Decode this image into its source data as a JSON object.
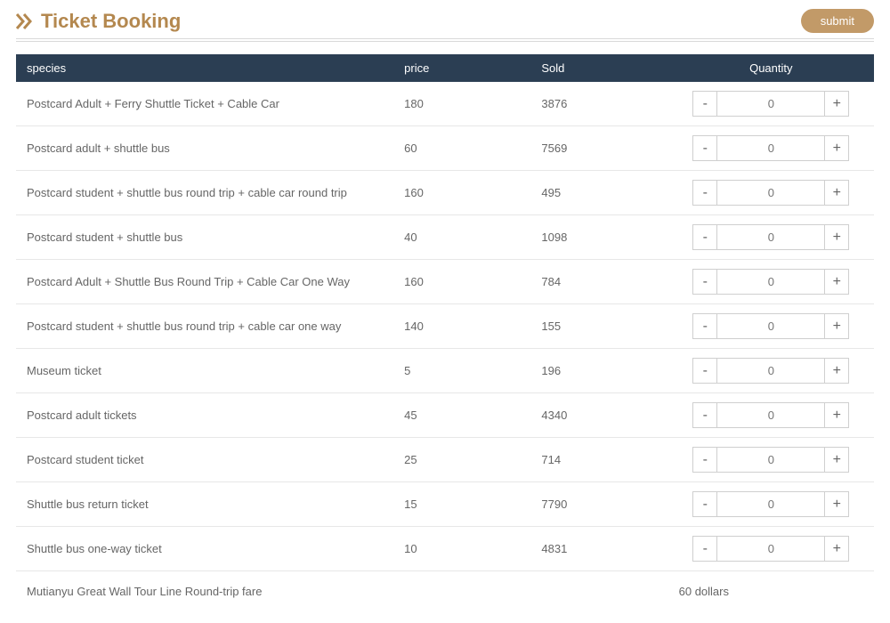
{
  "header": {
    "title": "Ticket Booking",
    "submit_label": "submit"
  },
  "columns": {
    "species": "species",
    "price": "price",
    "sold": "Sold",
    "quantity": "Quantity"
  },
  "stepper": {
    "minus": "-",
    "plus": "+",
    "placeholder": "0"
  },
  "rows": [
    {
      "species": "Postcard Adult + Ferry Shuttle Ticket + Cable Car",
      "price": "180",
      "sold": "3876"
    },
    {
      "species": "Postcard adult + shuttle bus",
      "price": "60",
      "sold": "7569"
    },
    {
      "species": "Postcard student + shuttle bus round trip + cable car round trip",
      "price": "160",
      "sold": "495"
    },
    {
      "species": "Postcard student + shuttle bus",
      "price": "40",
      "sold": "1098"
    },
    {
      "species": "Postcard Adult + Shuttle Bus Round Trip + Cable Car One Way",
      "price": "160",
      "sold": "784"
    },
    {
      "species": "Postcard student + shuttle bus round trip + cable car one way",
      "price": "140",
      "sold": "155"
    },
    {
      "species": "Museum ticket",
      "price": "5",
      "sold": "196"
    },
    {
      "species": "Postcard adult tickets",
      "price": "45",
      "sold": "4340"
    },
    {
      "species": "Postcard student ticket",
      "price": "25",
      "sold": "714"
    },
    {
      "species": "Shuttle bus return ticket",
      "price": "15",
      "sold": "7790"
    },
    {
      "species": "Shuttle bus one-way ticket",
      "price": "10",
      "sold": "4831"
    }
  ],
  "footer": {
    "label": "Mutianyu Great Wall Tour Line Round-trip fare",
    "value": "60 dollars"
  }
}
